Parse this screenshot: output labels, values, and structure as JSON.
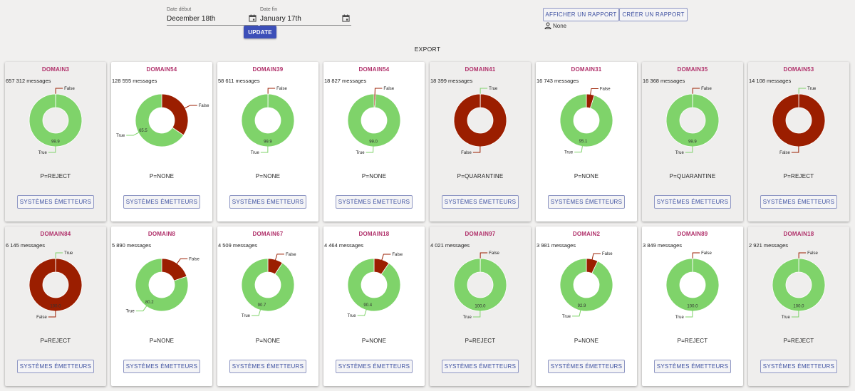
{
  "filters": {
    "start": {
      "label": "Date début",
      "value": "December 18th"
    },
    "end": {
      "label": "Date fin",
      "value": "January 17th"
    },
    "update_label": "UPDATE"
  },
  "reports": {
    "show_label": "AFFICHER UN RAPPORT",
    "create_label": "CRÉER UN RAPPORT",
    "user": "None"
  },
  "export_label": "EXPORT",
  "colors": {
    "true": "#7fd36a",
    "false": "#9b1e00",
    "accent": "#3c4fb8",
    "domain": "#b0306a"
  },
  "cards": [
    {
      "domain": "DOMAIN3",
      "messages": "657 312 messages",
      "policy": "P=REJECT",
      "button": "SYSTÈMES ÉMETTEURS",
      "shade": true,
      "chart_data": {
        "type": "pie",
        "categories": [
          "False",
          "True"
        ],
        "values": [
          0.1,
          99.9
        ],
        "labels": [
          "0.1",
          "99.9"
        ]
      }
    },
    {
      "domain": "DOMAIN54",
      "messages": "128 555 messages",
      "policy": "P=NONE",
      "button": "SYSTÈMES ÉMETTEURS",
      "shade": false,
      "chart_data": {
        "type": "pie",
        "categories": [
          "False",
          "True"
        ],
        "values": [
          34.5,
          65.5
        ],
        "labels": [
          "",
          "65.5"
        ]
      }
    },
    {
      "domain": "DOMAIN39",
      "messages": "58 611 messages",
      "policy": "P=NONE",
      "button": "SYSTÈMES ÉMETTEURS",
      "shade": false,
      "chart_data": {
        "type": "pie",
        "categories": [
          "False",
          "True"
        ],
        "values": [
          0.1,
          99.9
        ],
        "labels": [
          "0.1",
          "99.9"
        ]
      }
    },
    {
      "domain": "DOMAIN54",
      "messages": "18 827 messages",
      "policy": "P=NONE",
      "button": "SYSTÈMES ÉMETTEURS",
      "shade": false,
      "chart_data": {
        "type": "pie",
        "categories": [
          "False",
          "True"
        ],
        "values": [
          1.0,
          99.0
        ],
        "labels": [
          "",
          "99.0"
        ]
      }
    },
    {
      "domain": "DOMAIN41",
      "messages": "18 399 messages",
      "policy": "P=QUARANTINE",
      "button": "SYSTÈMES ÉMETTEURS",
      "shade": true,
      "chart_data": {
        "type": "pie",
        "categories": [
          "True",
          "False"
        ],
        "values": [
          0.1,
          99.9
        ],
        "labels": [
          "",
          ""
        ]
      }
    },
    {
      "domain": "DOMAIN31",
      "messages": "16 743 messages",
      "policy": "P=NONE",
      "button": "SYSTÈMES ÉMETTEURS",
      "shade": false,
      "chart_data": {
        "type": "pie",
        "categories": [
          "False",
          "True"
        ],
        "values": [
          4.9,
          95.1
        ],
        "labels": [
          "",
          "95.1"
        ]
      }
    },
    {
      "domain": "DOMAIN35",
      "messages": "16 368 messages",
      "policy": "P=QUARANTINE",
      "button": "SYSTÈMES ÉMETTEURS",
      "shade": true,
      "chart_data": {
        "type": "pie",
        "categories": [
          "False",
          "True"
        ],
        "values": [
          0.1,
          99.9
        ],
        "labels": [
          "0.1",
          "99.9"
        ]
      }
    },
    {
      "domain": "DOMAIN53",
      "messages": "14 108 messages",
      "policy": "P=REJECT",
      "button": "SYSTÈMES ÉMETTEURS",
      "shade": true,
      "chart_data": {
        "type": "pie",
        "categories": [
          "True",
          "False"
        ],
        "values": [
          0.1,
          99.9
        ],
        "labels": [
          "",
          ""
        ]
      }
    },
    {
      "domain": "DOMAIN84",
      "messages": "6 145 messages",
      "policy": "P=REJECT",
      "button": "SYSTÈMES ÉMETTEURS",
      "shade": true,
      "chart_data": {
        "type": "pie",
        "categories": [
          "True",
          "False"
        ],
        "values": [
          0.1,
          99.9
        ],
        "labels": [
          "",
          "100.0"
        ]
      }
    },
    {
      "domain": "DOMAIN8",
      "messages": "5 890 messages",
      "policy": "P=NONE",
      "button": "SYSTÈMES ÉMETTEURS",
      "shade": false,
      "chart_data": {
        "type": "pie",
        "categories": [
          "False",
          "True"
        ],
        "values": [
          19.8,
          80.2
        ],
        "labels": [
          "",
          "80.2"
        ]
      }
    },
    {
      "domain": "DOMAIN67",
      "messages": "4 509 messages",
      "policy": "P=NONE",
      "button": "SYSTÈMES ÉMETTEURS",
      "shade": false,
      "chart_data": {
        "type": "pie",
        "categories": [
          "False",
          "True"
        ],
        "values": [
          9.3,
          90.7
        ],
        "labels": [
          "",
          "90.7"
        ]
      }
    },
    {
      "domain": "DOMAIN18",
      "messages": "4 464 messages",
      "policy": "P=NONE",
      "button": "SYSTÈMES ÉMETTEURS",
      "shade": false,
      "chart_data": {
        "type": "pie",
        "categories": [
          "False",
          "True"
        ],
        "values": [
          9.6,
          90.4
        ],
        "labels": [
          "",
          "90.4"
        ]
      }
    },
    {
      "domain": "DOMAIN97",
      "messages": "4 021 messages",
      "policy": "P=REJECT",
      "button": "SYSTÈMES ÉMETTEURS",
      "shade": true,
      "chart_data": {
        "type": "pie",
        "categories": [
          "False",
          "True"
        ],
        "values": [
          0.1,
          99.9
        ],
        "labels": [
          "",
          "100.0"
        ]
      }
    },
    {
      "domain": "DOMAIN2",
      "messages": "3 981 messages",
      "policy": "P=NONE",
      "button": "SYSTÈMES ÉMETTEURS",
      "shade": false,
      "chart_data": {
        "type": "pie",
        "categories": [
          "False",
          "True"
        ],
        "values": [
          7.1,
          92.9
        ],
        "labels": [
          "",
          "92.9"
        ]
      }
    },
    {
      "domain": "DOMAIN89",
      "messages": "3 849 messages",
      "policy": "P=REJECT",
      "button": "SYSTÈMES ÉMETTEURS",
      "shade": false,
      "chart_data": {
        "type": "pie",
        "categories": [
          "False",
          "True"
        ],
        "values": [
          0.1,
          99.9
        ],
        "labels": [
          "",
          "100.0"
        ]
      }
    },
    {
      "domain": "DOMAIN18",
      "messages": "2 921 messages",
      "policy": "P=REJECT",
      "button": "SYSTÈMES ÉMETTEURS",
      "shade": true,
      "chart_data": {
        "type": "pie",
        "categories": [
          "False",
          "True"
        ],
        "values": [
          0.1,
          99.9
        ],
        "labels": [
          "",
          "100.0"
        ]
      }
    }
  ]
}
